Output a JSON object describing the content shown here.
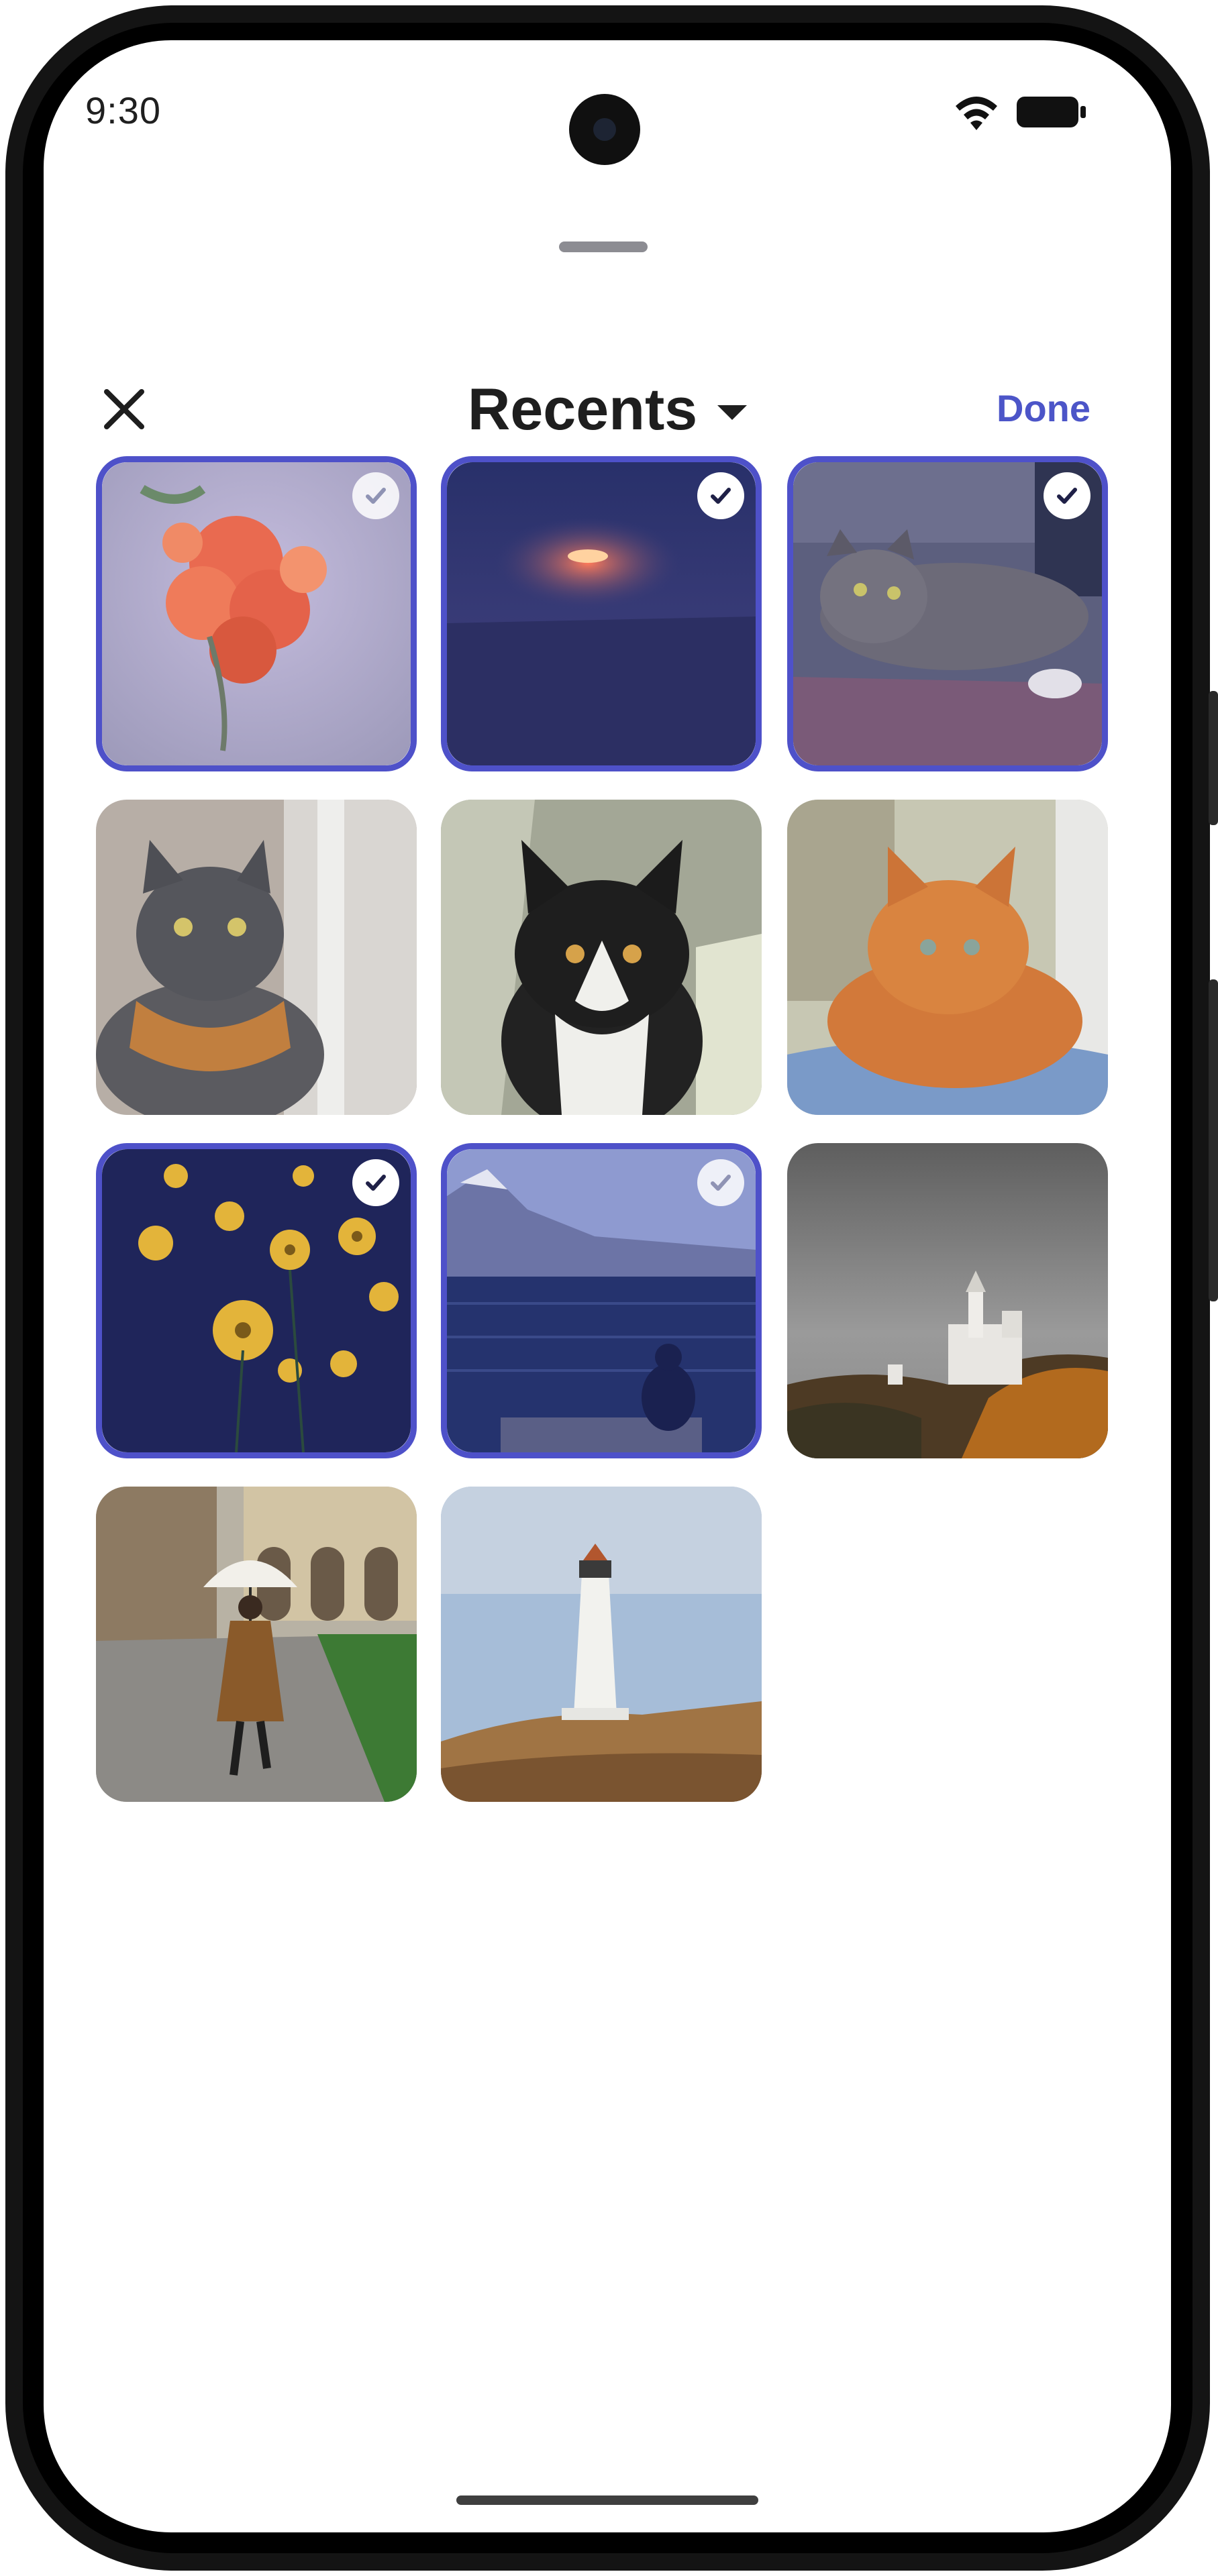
{
  "status": {
    "time": "9:30"
  },
  "header": {
    "title": "Recents",
    "done_label": "Done"
  },
  "icons": {
    "close": "close-icon",
    "dropdown": "chevron-down-icon",
    "wifi": "wifi-icon",
    "battery": "battery-icon",
    "check": "checkmark-icon"
  },
  "colors": {
    "accent": "#4e51c9",
    "done_text": "#4c55c8"
  },
  "photos": [
    {
      "subject": "flowers",
      "selected": true
    },
    {
      "subject": "sunset-sea",
      "selected": true
    },
    {
      "subject": "tabby-cat",
      "selected": true
    },
    {
      "subject": "gray-cat-sweater",
      "selected": false
    },
    {
      "subject": "tuxedo-cat",
      "selected": false
    },
    {
      "subject": "orange-cat",
      "selected": false
    },
    {
      "subject": "yellow-daisies",
      "selected": true
    },
    {
      "subject": "person-by-lake",
      "selected": true
    },
    {
      "subject": "castle-fog",
      "selected": false
    },
    {
      "subject": "umbrella-walk",
      "selected": false
    },
    {
      "subject": "lighthouse",
      "selected": false
    }
  ]
}
